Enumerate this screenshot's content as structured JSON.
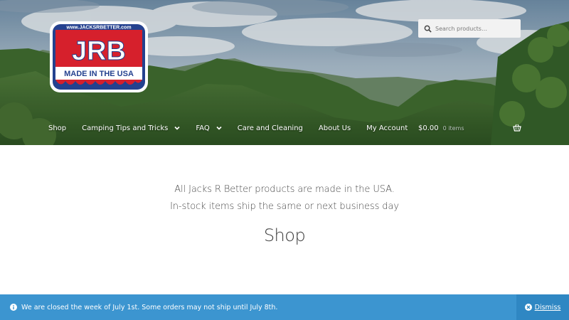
{
  "header": {
    "logo": {
      "url_text": "www.JACKSRBETTER.com",
      "initials": "JRB",
      "tagline": "MADE IN THE USA"
    },
    "search": {
      "placeholder": "Search products…"
    },
    "nav": [
      {
        "label": "Shop",
        "dropdown": false
      },
      {
        "label": "Camping Tips and Tricks",
        "dropdown": true
      },
      {
        "label": "FAQ",
        "dropdown": true
      },
      {
        "label": "Care and Cleaning",
        "dropdown": false
      },
      {
        "label": "About Us",
        "dropdown": false
      },
      {
        "label": "My Account",
        "dropdown": false
      }
    ],
    "cart": {
      "total": "$0.00",
      "count": "0 items"
    }
  },
  "content": {
    "intro_line1": "All Jacks R Better products are made in the USA.",
    "intro_line2": "In-stock items ship the same or next business day",
    "title": "Shop"
  },
  "notice": {
    "message": "We are closed the week of July 1st. Some orders may not ship until July 8th.",
    "dismiss_label": "Dismiss"
  },
  "colors": {
    "notice_bg": "#3c95d0",
    "logo_red": "#d6202c",
    "logo_blue": "#24418f"
  }
}
